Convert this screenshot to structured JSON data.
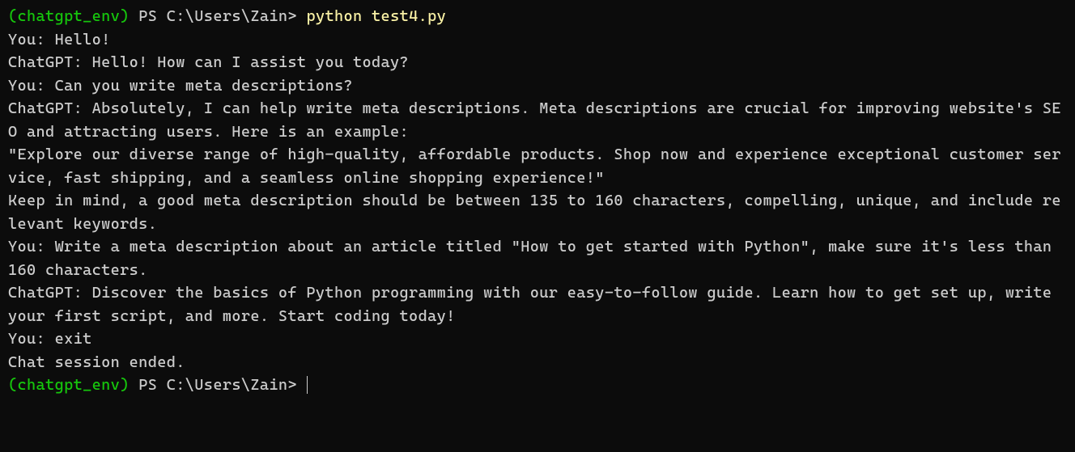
{
  "prompt1": {
    "env_open": "(",
    "env_name": "chatgpt_env",
    "env_close": ")",
    "ps": " PS ",
    "path": "C:\\Users\\Zain",
    "gt": "> ",
    "command": "python test4.py"
  },
  "output": {
    "line1": "You: Hello!",
    "line2": "ChatGPT: Hello! How can I assist you today?",
    "line3": "You: Can you write meta descriptions?",
    "line4": "ChatGPT: Absolutely, I can help write meta descriptions. Meta descriptions are crucial for improving website's SEO and attracting users. Here is an example:",
    "blank1": "",
    "line5": "\"Explore our diverse range of high-quality, affordable products. Shop now and experience exceptional customer service, fast shipping, and a seamless online shopping experience!\"",
    "blank2": "",
    "line6": "Keep in mind, a good meta description should be between 135 to 160 characters, compelling, unique, and include relevant keywords.",
    "line7": "You: Write a meta description about an article titled \"How to get started with Python\", make sure it's less than 160 characters.",
    "line8": "ChatGPT: Discover the basics of Python programming with our easy-to-follow guide. Learn how to get set up, write your first script, and more. Start coding today!",
    "line9": "You: exit",
    "line10": "Chat session ended."
  },
  "prompt2": {
    "env_open": "(",
    "env_name": "chatgpt_env",
    "env_close": ")",
    "ps": " PS ",
    "path": "C:\\Users\\Zain",
    "gt": "> "
  }
}
